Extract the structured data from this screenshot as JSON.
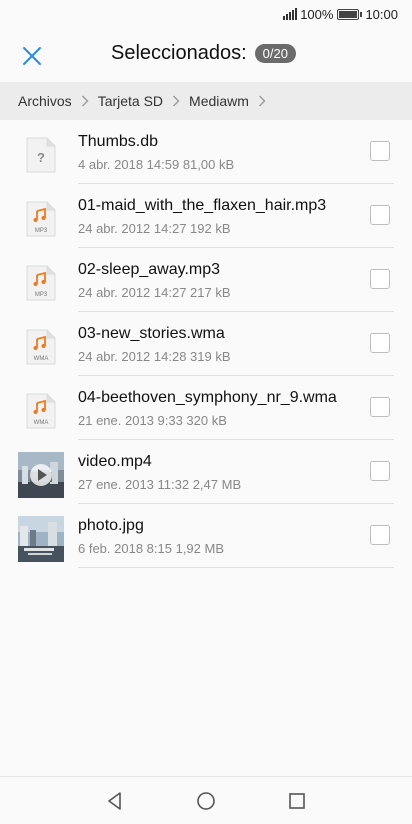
{
  "status_bar": {
    "battery": "100%",
    "time": "10:00"
  },
  "header": {
    "title": "Seleccionados:",
    "count": "0/20",
    "close_icon": "close-icon",
    "accent_color": "#2a8be0"
  },
  "breadcrumb": [
    "Archivos",
    "Tarjeta SD",
    "Mediawm"
  ],
  "files": [
    {
      "name": "Thumbs.db",
      "meta": "4 abr. 2018 14:59 81,00 kB",
      "icon": "unknown-file-icon",
      "type_label": ""
    },
    {
      "name": "01-maid_with_the_flaxen_hair.mp3",
      "meta": "24 abr. 2012 14:27 192 kB",
      "icon": "audio-file-icon",
      "type_label": "MP3"
    },
    {
      "name": "02-sleep_away.mp3",
      "meta": "24 abr. 2012 14:27 217 kB",
      "icon": "audio-file-icon",
      "type_label": "MP3"
    },
    {
      "name": "03-new_stories.wma",
      "meta": "24 abr. 2012 14:28 319 kB",
      "icon": "audio-file-icon",
      "type_label": "WMA"
    },
    {
      "name": "04-beethoven_symphony_nr_9.wma",
      "meta": "21 ene. 2013 9:33 320 kB",
      "icon": "audio-file-icon",
      "type_label": "WMA"
    },
    {
      "name": "video.mp4",
      "meta": "27 ene. 2013 11:32 2,47 MB",
      "icon": "video-thumbnail",
      "type_label": ""
    },
    {
      "name": "photo.jpg",
      "meta": "6 feb. 2018 8:15 1,92 MB",
      "icon": "photo-thumbnail",
      "type_label": ""
    }
  ],
  "nav_bar": {
    "back_icon": "back-icon",
    "home_icon": "home-icon",
    "recents_icon": "recents-icon"
  }
}
